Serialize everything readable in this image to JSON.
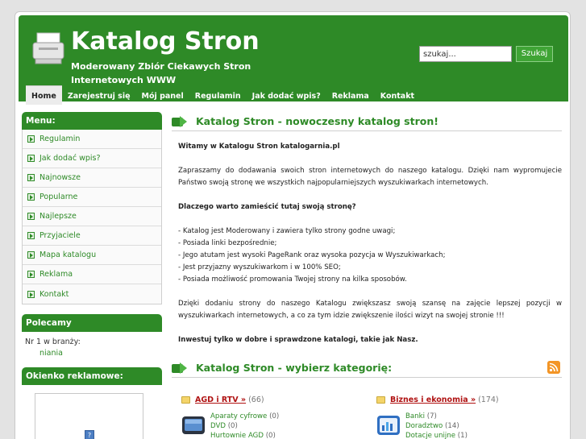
{
  "header": {
    "title": "Katalog Stron",
    "subtitle": "Moderowany Zbiór Ciekawych Stron Internetowych WWW",
    "search_placeholder": "szukaj...",
    "search_button": "Szukaj",
    "logo_icon": "printer-icon"
  },
  "nav": [
    "Home",
    "Zarejestruj się",
    "Mój panel",
    "Regulamin",
    "Jak dodać wpis?",
    "Reklama",
    "Kontakt"
  ],
  "sidebar": {
    "menu_title": "Menu:",
    "menu_items": [
      "Regulamin",
      "Jak dodać wpis?",
      "Najnowsze",
      "Popularne",
      "Najlepsze",
      "Przyjaciele",
      "Mapa katalogu",
      "Reklama",
      "Kontakt"
    ],
    "polecamy_title": "Polecamy",
    "polecamy_text": "Nr 1 w branży:",
    "polecamy_link": "niania",
    "ad_title": "Okienko reklamowe:"
  },
  "main": {
    "section1_title": "Katalog Stron - nowoczesny katalog stron!",
    "welcome": "Witamy w Katalogu Stron katalogarnia.pl",
    "intro": "Zapraszamy do dodawania swoich stron internetowych do naszego katalogu. Dzięki nam wypromujecie Państwo swoją stronę we wszystkich najpopularniejszych wyszukiwarkach internetowych.",
    "why_title": "Dlaczego warto zamieścić tutaj swoją stronę?",
    "reasons": [
      "- Katalog jest Moderowany i zawiera tylko strony godne uwagi;",
      "- Posiada linki bezpośrednie;",
      "- Jego atutam jest wysoki PageRank oraz wysoka pozycja w Wyszukiwarkach;",
      "- Jest przyjazny wyszukiwarkom i w 100% SEO;",
      "- Posiada możliwość promowania Twojej strony na kilka sposobów."
    ],
    "outro": "Dzięki dodaniu strony do naszego Katalogu zwiększasz swoją szansę na zajęcie lepszej pozycji w wyszukiwarkach internetowych, a co za tym idzie zwiększenie ilości wizyt na swojej stronie !!!",
    "cta": "Inwestuj tylko w dobre i sprawdzone katalogi, takie jak Nasz.",
    "section2_title": "Katalog Stron - wybierz kategorię:"
  },
  "categories": [
    {
      "name": "AGD i RTV »",
      "count": "(66)",
      "subs": [
        {
          "name": "Aparaty cyfrowe",
          "count": "(0)"
        },
        {
          "name": "DVD",
          "count": "(0)"
        },
        {
          "name": "Hurtownie AGD",
          "count": "(0)"
        }
      ]
    },
    {
      "name": "Biznes i ekonomia »",
      "count": "(174)",
      "subs": [
        {
          "name": "Banki",
          "count": "(7)"
        },
        {
          "name": "Doradztwo",
          "count": "(14)"
        },
        {
          "name": "Dotacje unijne",
          "count": "(1)"
        }
      ]
    }
  ]
}
